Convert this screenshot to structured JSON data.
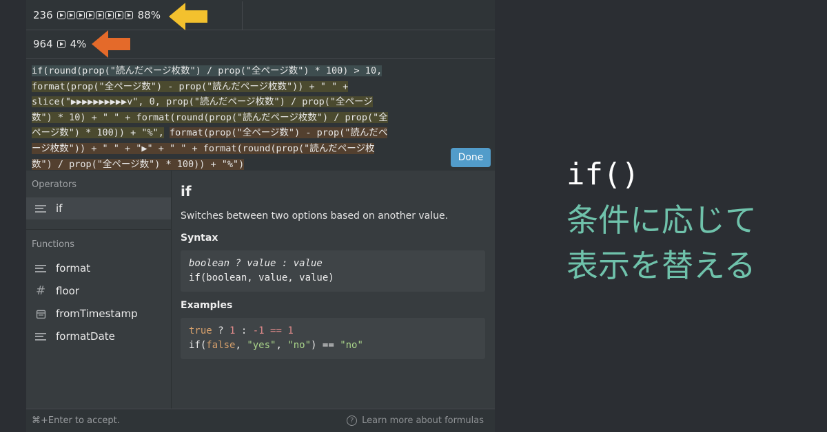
{
  "rows": [
    {
      "count": "236",
      "icons": 8,
      "percent": "88%"
    },
    {
      "count": "964",
      "icons": 1,
      "percent": "4%"
    }
  ],
  "arrows": {
    "first": "#f3c12e",
    "second": "#e46a2a"
  },
  "formula": {
    "line1": "if(round(prop(\"読んだページ枚数\") / prop(\"全ページ数\") * 100) > 10,",
    "line2": "format(prop(\"全ページ数\") - prop(\"読んだページ枚数\")) + \" \" +",
    "line3": "slice(\"▶▶▶▶▶▶▶▶▶▶v\", 0, prop(\"読んだページ枚数\") / prop(\"全ページ",
    "line4": "数\") * 10) + \" \" + format(round(prop(\"読んだページ枚数\") / prop(\"全",
    "line5a": "ページ数\") * 100)) + \"%\",",
    "line5b": "format(prop(\"全ページ数\") - prop(\"読んだペ",
    "line6": "ージ枚数\")) + \" \" + \"▶\" + \" \" + format(round(prop(\"読んだページ枚",
    "line7": "数\") / prop(\"全ページ数\") * 100)) + \"%\")",
    "done_label": "Done"
  },
  "sidebar": {
    "operators_label": "Operators",
    "operators": [
      {
        "label": "if",
        "icon": "text-lines-icon"
      }
    ],
    "functions_label": "Functions",
    "functions": [
      {
        "label": "format",
        "icon": "text-lines-icon"
      },
      {
        "label": "floor",
        "icon": "hash-icon"
      },
      {
        "label": "fromTimestamp",
        "icon": "calendar-icon"
      },
      {
        "label": "formatDate",
        "icon": "text-lines-icon"
      }
    ]
  },
  "doc": {
    "title": "if",
    "description": "Switches between two options based on another value.",
    "syntax_label": "Syntax",
    "syntax_line1": "boolean ? value : value",
    "syntax_line2": "if(boolean, value, value)",
    "examples_label": "Examples",
    "ex1": {
      "kw": "true",
      "op1": " ? ",
      "n1": "1",
      "op2": " : ",
      "n2": "-1",
      "op3": " == ",
      "n3": "1"
    },
    "ex2": {
      "pre": "if(",
      "kw": "false",
      "c1": ", ",
      "s1": "\"yes\"",
      "c2": ", ",
      "s2": "\"no\"",
      "post": ") == ",
      "s3": "\"no\""
    }
  },
  "footer": {
    "hint": "⌘+Enter to accept.",
    "learn": "Learn more about formulas"
  },
  "caption": {
    "code": "if()",
    "line1": "条件に応じて",
    "line2": "表示を替える",
    "accent": "#6fc2ab"
  }
}
